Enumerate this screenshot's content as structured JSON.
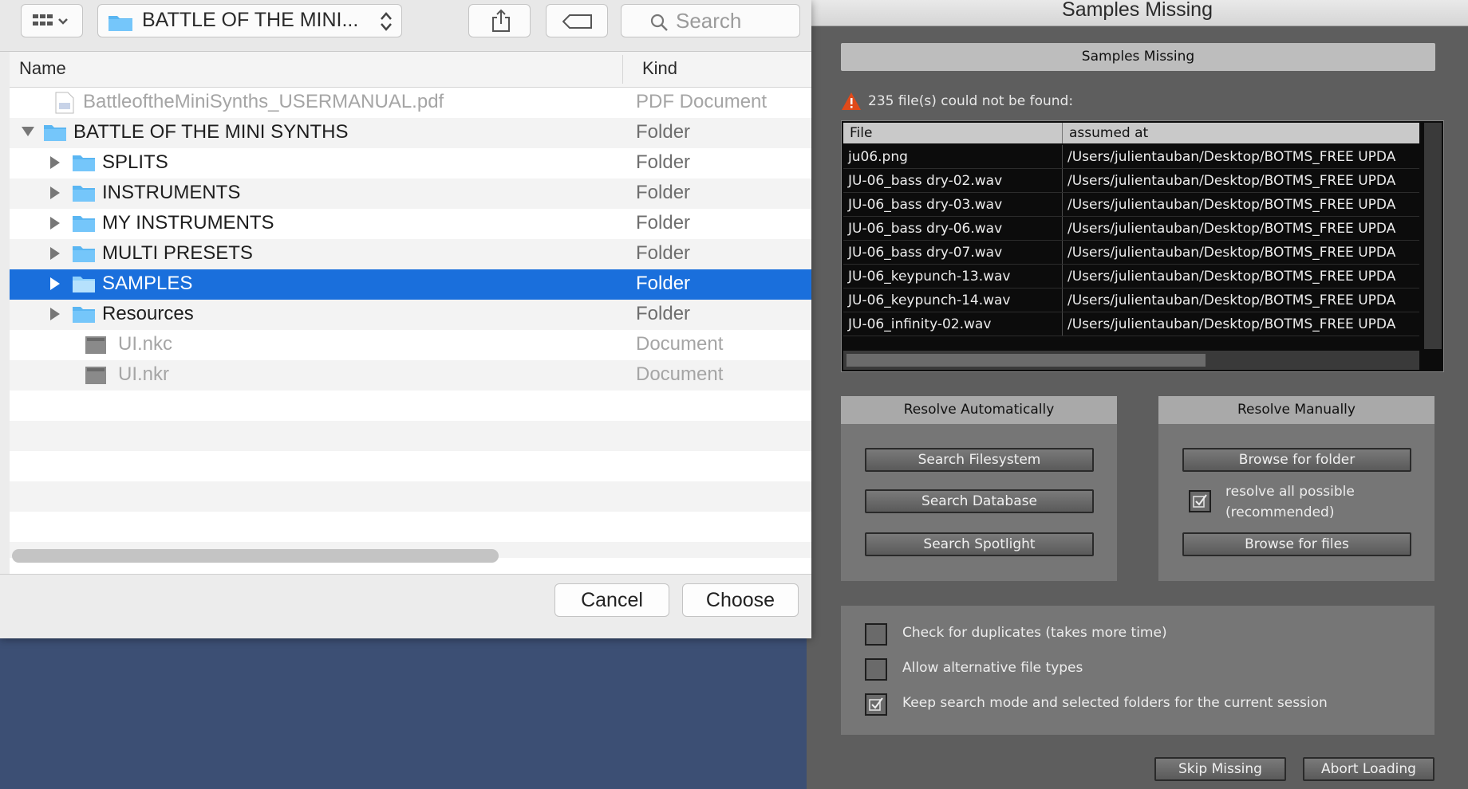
{
  "finder": {
    "path_label": "BATTLE OF THE MINI...",
    "search_placeholder": "Search",
    "columns": {
      "name": "Name",
      "kind": "Kind"
    },
    "rows": [
      {
        "name": "BattleoftheMiniSynths_USERMANUAL.pdf",
        "kind": "PDF Document"
      },
      {
        "name": "BATTLE OF THE MINI SYNTHS",
        "kind": "Folder"
      },
      {
        "name": "SPLITS",
        "kind": "Folder"
      },
      {
        "name": "INSTRUMENTS",
        "kind": "Folder"
      },
      {
        "name": "MY INSTRUMENTS",
        "kind": "Folder"
      },
      {
        "name": "MULTI PRESETS",
        "kind": "Folder"
      },
      {
        "name": "SAMPLES",
        "kind": "Folder"
      },
      {
        "name": "Resources",
        "kind": "Folder"
      },
      {
        "name": "UI.nkc",
        "kind": "Document"
      },
      {
        "name": "UI.nkr",
        "kind": "Document"
      }
    ],
    "cancel_label": "Cancel",
    "choose_label": "Choose"
  },
  "kontakt": {
    "window_title": "Samples Missing",
    "header": "Samples Missing",
    "warning": "235 file(s) could not be found:",
    "table_columns": {
      "file": "File",
      "path": "assumed at"
    },
    "files": [
      {
        "file": "ju06.png",
        "path": "/Users/julientauban/Desktop/BOTMS_FREE UPDA"
      },
      {
        "file": "JU-06_bass dry-02.wav",
        "path": "/Users/julientauban/Desktop/BOTMS_FREE UPDA"
      },
      {
        "file": "JU-06_bass dry-03.wav",
        "path": "/Users/julientauban/Desktop/BOTMS_FREE UPDA"
      },
      {
        "file": "JU-06_bass dry-06.wav",
        "path": "/Users/julientauban/Desktop/BOTMS_FREE UPDA"
      },
      {
        "file": "JU-06_bass dry-07.wav",
        "path": "/Users/julientauban/Desktop/BOTMS_FREE UPDA"
      },
      {
        "file": "JU-06_keypunch-13.wav",
        "path": "/Users/julientauban/Desktop/BOTMS_FREE UPDA"
      },
      {
        "file": "JU-06_keypunch-14.wav",
        "path": "/Users/julientauban/Desktop/BOTMS_FREE UPDA"
      },
      {
        "file": "JU-06_infinity-02.wav",
        "path": "/Users/julientauban/Desktop/BOTMS_FREE UPDA"
      }
    ],
    "auto": {
      "title": "Resolve Automatically",
      "search_filesystem": "Search Filesystem",
      "search_database": "Search Database",
      "search_spotlight": "Search Spotlight"
    },
    "manual": {
      "title": "Resolve Manually",
      "browse_folder": "Browse for folder",
      "resolve_all_line1": "resolve all possible",
      "resolve_all_line2": "(recommended)",
      "browse_files": "Browse for files"
    },
    "options": {
      "check_duplicates": "Check for duplicates (takes more time)",
      "allow_alternative": "Allow alternative file types",
      "keep_search_mode": "Keep search mode and selected folders for the current session"
    },
    "skip_missing": "Skip Missing",
    "abort_loading": "Abort Loading"
  }
}
